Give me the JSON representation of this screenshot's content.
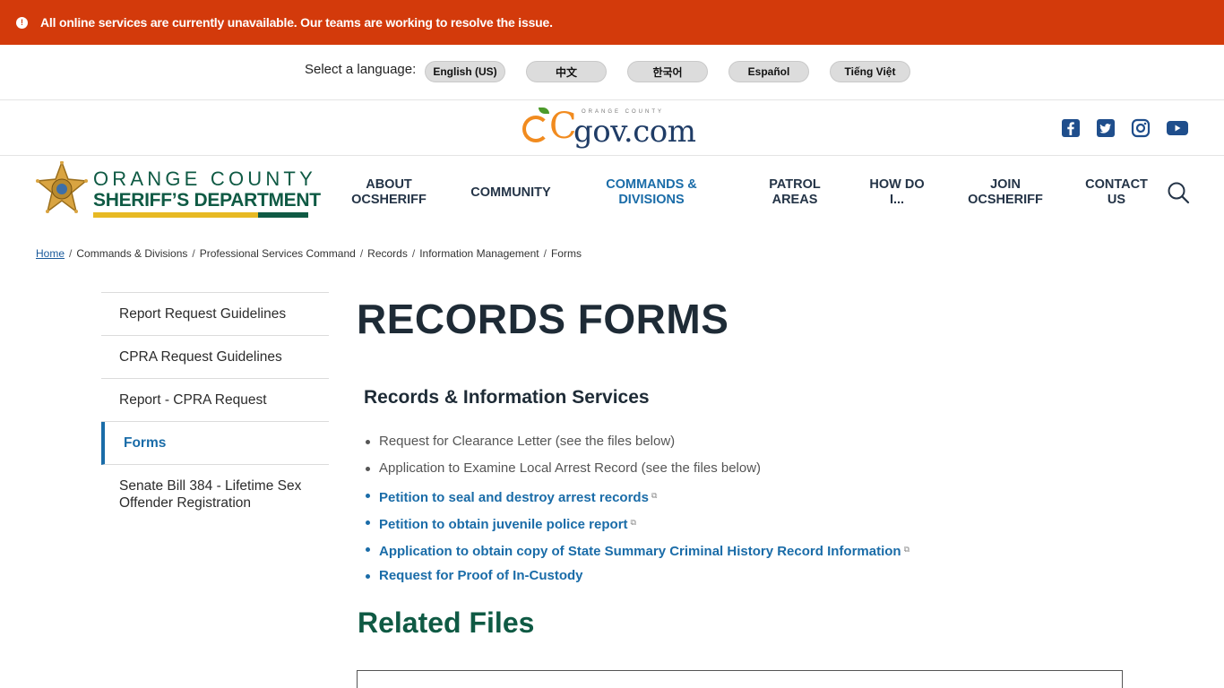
{
  "alert": {
    "icon": "info-icon",
    "text": "All online services are currently unavailable. Our teams are working to resolve the issue."
  },
  "language": {
    "label": "Select a language:",
    "options": [
      "English (US)",
      "中文",
      "한국어",
      "Español",
      "Tiếng Việt"
    ]
  },
  "ocgov": {
    "logo_text": "gov.com",
    "logo_prefix": "OC",
    "logo_small": "ORANGE COUNTY",
    "social": [
      "facebook-icon",
      "twitter-icon",
      "instagram-icon",
      "youtube-icon"
    ]
  },
  "sheriff": {
    "line1": "ORANGE COUNTY",
    "line2": "SHERIFF’S DEPARTMENT"
  },
  "nav": {
    "items": [
      "ABOUT OCSHERIFF",
      "COMMUNITY",
      "COMMANDS & DIVISIONS",
      "PATROL AREAS",
      "HOW DO I...",
      "JOIN OCSHERIFF",
      "CONTACT US"
    ]
  },
  "breadcrumb": {
    "home": "Home",
    "items": [
      "Commands & Divisions",
      "Professional Services Command",
      "Records",
      "Information Management",
      "Forms"
    ]
  },
  "sidenav": {
    "items": [
      "Report Request Guidelines",
      "CPRA Request Guidelines",
      "Report - CPRA Request",
      "Forms",
      "Senate Bill 384 - Lifetime Sex Offender Registration"
    ]
  },
  "main": {
    "title": "RECORDS FORMS",
    "section_title": "Records & Information Services",
    "list": [
      "Request for Clearance Letter  (see the files below)",
      "Application to Examine Local Arrest Record (see the files below)",
      "Petition to seal and destroy arrest records",
      "Petition to obtain juvenile police report",
      "Application to obtain copy of State Summary Criminal History Record Information",
      "Request for Proof of In-Custody"
    ],
    "related_title": "Related Files"
  },
  "colors": {
    "alert": "#d33a0b",
    "brand_green": "#0f5a44",
    "link_blue": "#1a6ca8",
    "gold": "#e7b923"
  }
}
